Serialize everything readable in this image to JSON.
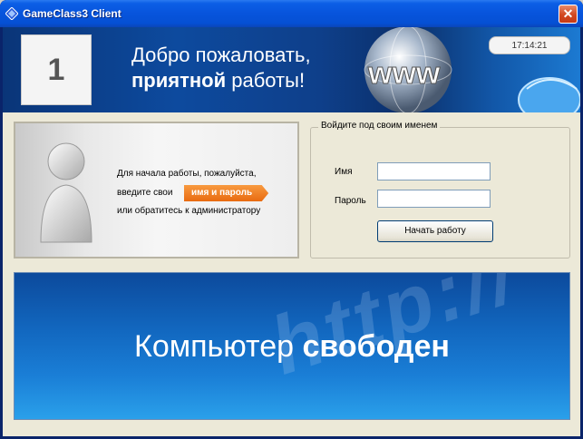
{
  "window": {
    "title": "GameClass3 Client",
    "close_glyph": "✕"
  },
  "banner": {
    "computer_number": "1",
    "welcome_line1": "Добро пожаловать,",
    "welcome_line2_bold": "приятной",
    "welcome_line2_rest": " работы!",
    "clock": "17:14:21",
    "globe_text": "www"
  },
  "info": {
    "line1": "Для начала работы, пожалуйста,",
    "line2": "введите свои",
    "highlight": "имя и пароль",
    "line3": "или обратитесь к администратору"
  },
  "login": {
    "legend": "Войдите под своим именем",
    "name_label": "Имя",
    "name_value": "",
    "password_label": "Пароль",
    "password_value": "",
    "start_button": "Начать работу"
  },
  "status": {
    "text_regular": "Компьютер ",
    "text_bold": "свободен",
    "deco": "http://"
  },
  "colors": {
    "titlebar": "#0754dc",
    "banner": "#0d4a9e",
    "highlight": "#e86a10",
    "free_banner": "#1a7ed6"
  }
}
